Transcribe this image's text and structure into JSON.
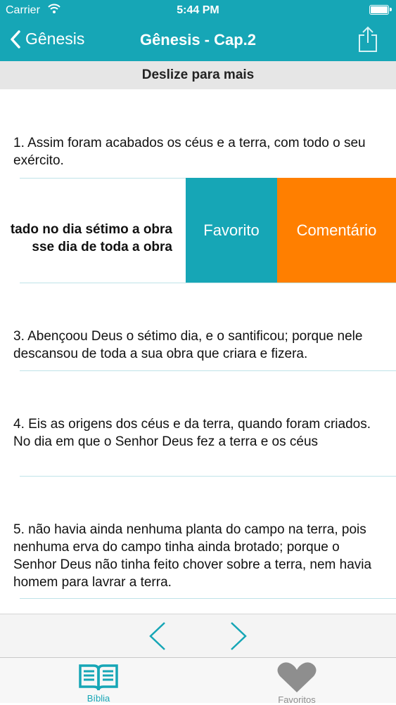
{
  "status_bar": {
    "carrier": "Carrier",
    "time": "5:44 PM"
  },
  "nav": {
    "back_label": "Gênesis",
    "title": "Gênesis - Cap.2"
  },
  "swipe_hint": "Deslize para mais",
  "verses": [
    {
      "text": "1. Assim foram acabados os céus e a terra, com todo o seu exército."
    },
    {
      "line1": "tado no dia sétimo a obra",
      "line2": "sse dia de toda a obra"
    },
    {
      "text": "3. Abençoou Deus o sétimo dia, e o santificou; porque nele descansou de toda a sua obra que criara e fizera."
    },
    {
      "text": "4. Eis as origens dos céus e da terra, quando foram criados. No dia em que o Senhor Deus fez a terra e os céus"
    },
    {
      "text": "5. não havia ainda nenhuma planta do campo na terra, pois nenhuma erva do campo tinha ainda brotado; porque o Senhor Deus não tinha feito chover sobre a terra, nem havia homem para lavrar a terra."
    }
  ],
  "swipe_actions": {
    "favorite": "Favorito",
    "comment": "Comentário"
  },
  "tabs": [
    {
      "label": "Bíblia",
      "icon": "book-icon"
    },
    {
      "label": "Favoritos",
      "icon": "heart-icon"
    }
  ],
  "colors": {
    "accent": "#16a6b6",
    "comment": "#ff7f00",
    "inactive": "#8e8e8e"
  }
}
